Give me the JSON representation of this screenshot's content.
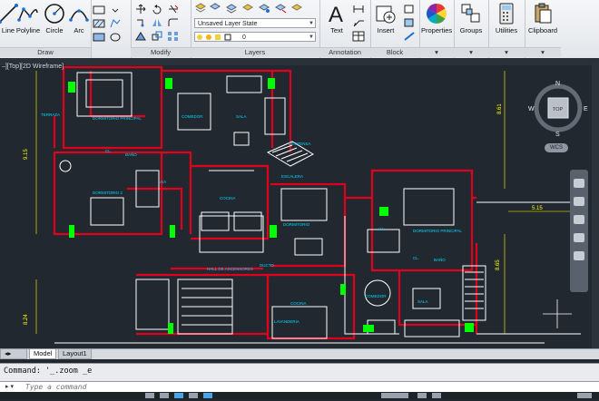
{
  "ribbon": {
    "draw": {
      "title": "Draw",
      "tools": [
        {
          "name": "line",
          "label": "Line"
        },
        {
          "name": "polyline",
          "label": "Polyline"
        },
        {
          "name": "circle",
          "label": "Circle"
        },
        {
          "name": "arc",
          "label": "Arc"
        }
      ]
    },
    "modify": {
      "title": "Modify"
    },
    "layers": {
      "title": "Layers",
      "layer_state": "Unsaved Layer State",
      "current_layer": "0"
    },
    "annotation": {
      "title": "Annotation",
      "text_label": "Text"
    },
    "block": {
      "title": "Block",
      "insert_label": "Insert"
    },
    "properties": {
      "label": "Properties"
    },
    "groups": {
      "label": "Groups"
    },
    "utilities": {
      "label": "Utilities"
    },
    "clipboard": {
      "label": "Clipboard"
    }
  },
  "viewport": {
    "label": "–][Top][2D Wireframe]"
  },
  "viewcube": {
    "top": "TOP",
    "n": "N",
    "s": "S",
    "e": "E",
    "w": "W",
    "wcs": "WCS"
  },
  "drawing": {
    "rooms": [
      "DORMITORIO PRINCIPAL",
      "COMEDOR",
      "SALA",
      "DORMITORIO 2",
      "COCINA",
      "HALL DE ASCENSORES",
      "DORMITORIO PRINCIPAL",
      "COMEDOR",
      "COCINA",
      "SALA",
      "DORMITORIO",
      "CL.",
      "CL.",
      "BAÑO",
      "BAÑO",
      "A/A",
      "A/A",
      "TERRAZA",
      "DUCTO",
      "ESCALERA",
      "LAVANDERIA",
      "DESPENSA"
    ],
    "dimensions": [
      "9.15",
      "8.61",
      "8.65",
      "8.24",
      "5.15"
    ]
  },
  "layout_tabs": [
    "Model",
    "Layout1"
  ],
  "command": {
    "history": "Command:  '_.zoom _e",
    "placeholder": "Type a command"
  },
  "colors": {
    "background": "#212830",
    "walls": "#e0001c",
    "lines": "#ffffff",
    "labels": "#00d9ff",
    "dimensions": "#ffff00",
    "openings": "#00ff00"
  }
}
